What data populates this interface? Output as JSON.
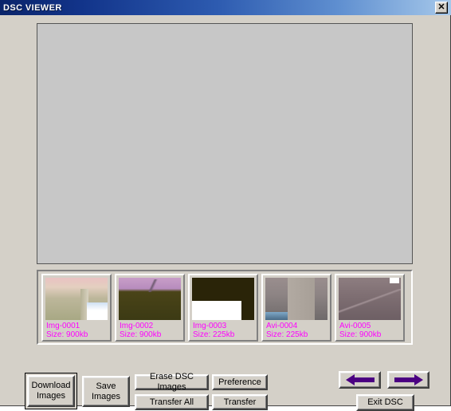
{
  "window": {
    "title": "DSC VIEWER",
    "close_glyph": "✕",
    "close_label": "Close"
  },
  "preview": {
    "name": "image-preview-area",
    "empty": true
  },
  "thumbnails": {
    "items": [
      {
        "label": "Img-0001",
        "size": "Size: 900kb",
        "photo_class": "photo-1"
      },
      {
        "label": "Img-0002",
        "size": "Size: 900kb",
        "photo_class": "photo-2"
      },
      {
        "label": "Img-0003",
        "size": "Size: 225kb",
        "photo_class": "photo-3"
      },
      {
        "label": "Avi-0004",
        "size": "Size: 225kb",
        "photo_class": "photo-4"
      },
      {
        "label": "Avi-0005",
        "size": "Size: 900kb",
        "photo_class": "photo-5"
      }
    ],
    "label_color": "#ff00ff"
  },
  "buttons": {
    "download_images": "Download\nImages",
    "download_images_line1": "Download",
    "download_images_line2": "Images",
    "save_images_line1": "Save",
    "save_images_line2": "Images",
    "erase_dsc_images": "Erase DSC Images",
    "preference": "Preference",
    "transfer_all": "Transfer All",
    "transfer": "Transfer",
    "exit_dsc": "Exit DSC",
    "prev_arrow_icon": "arrow-left-icon",
    "next_arrow_icon": "arrow-right-icon"
  },
  "colors": {
    "titlebar_start": "#0a246a",
    "titlebar_end": "#a6c8ea",
    "face": "#d4d0c8",
    "preview_fill": "#c7c7c7",
    "thumb_text": "#ff00ff",
    "arrow": "#4b0082"
  }
}
